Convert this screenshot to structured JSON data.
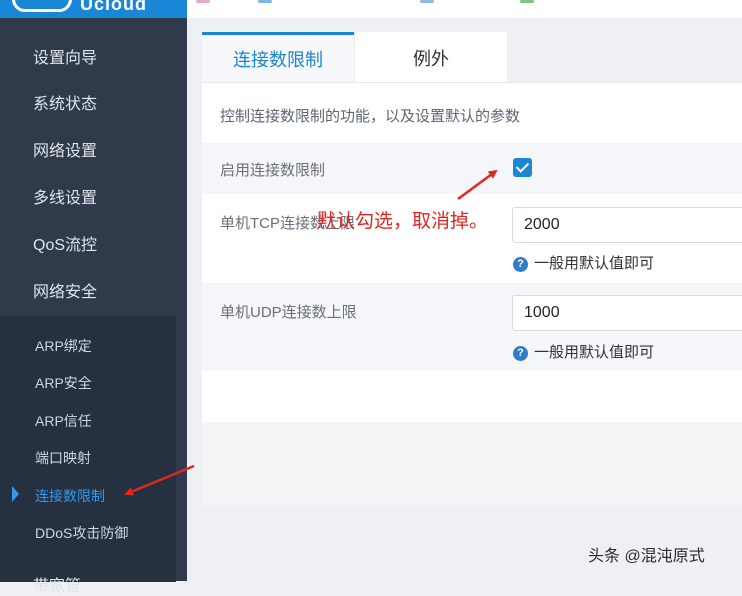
{
  "brand": {
    "name": "Ucloud"
  },
  "sidebar": {
    "items": [
      {
        "label": "设置向导"
      },
      {
        "label": "系统状态"
      },
      {
        "label": "网络设置"
      },
      {
        "label": "多线设置"
      },
      {
        "label": "QoS流控"
      },
      {
        "label": "网络安全"
      }
    ],
    "submenu": [
      {
        "label": "ARP绑定"
      },
      {
        "label": "ARP安全"
      },
      {
        "label": "ARP信任"
      },
      {
        "label": "端口映射"
      },
      {
        "label": "连接数限制",
        "active": true
      },
      {
        "label": "DDoS攻击防御"
      }
    ],
    "partial_label": "带宽管"
  },
  "tabs": [
    {
      "label": "连接数限制",
      "active": true
    },
    {
      "label": "例外",
      "active": false
    }
  ],
  "panel": {
    "description": "控制连接数限制的功能，以及设置默认的参数",
    "enable": {
      "label": "启用连接数限制",
      "checked": true
    },
    "tcp": {
      "label": "单机TCP连接数上限",
      "value": "2000",
      "hint": "一般用默认值即可"
    },
    "udp": {
      "label": "单机UDP连接数上限",
      "value": "1000",
      "hint": "一般用默认值即可"
    }
  },
  "annotation": {
    "text": "默认勾选，取消掉。"
  },
  "watermark": {
    "text": "头条 @混沌原式"
  },
  "colors": {
    "accent": "#1a86d6",
    "sidebar": "#2f3a4a",
    "annotation": "#e0261f"
  }
}
